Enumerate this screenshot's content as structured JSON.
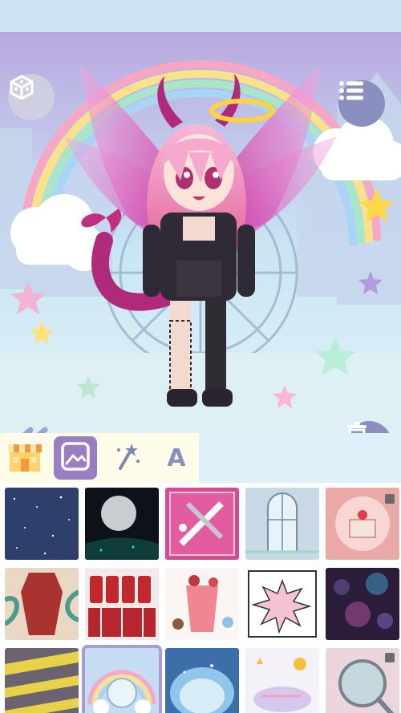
{
  "scene": {
    "buttons": {
      "random": "dice-icon",
      "menu": "list-menu-icon",
      "back": "double-chevron-left-icon",
      "delete": "trash-icon"
    }
  },
  "toolbar": {
    "tabs": [
      {
        "name": "shop",
        "icon": "shop-icon",
        "active": false
      },
      {
        "name": "background",
        "icon": "picture-frame-icon",
        "active": true
      },
      {
        "name": "effects",
        "icon": "magic-wand-icon",
        "active": false
      },
      {
        "name": "text",
        "label": "A",
        "active": false
      }
    ]
  },
  "backgrounds": {
    "rows": [
      [
        "night-sky",
        "full-moon-night",
        "syringe-pills",
        "arched-window-room",
        "strawberry-cake"
      ],
      [
        "red-coffin-vines",
        "blood-bags",
        "parfait-dessert",
        "comic-burst",
        "purple-bokeh"
      ],
      [
        "caution-tape",
        "rainbow-bubble-car",
        "starry-ice-cave",
        "sun-cloud-doodle",
        "magnifier-locked"
      ]
    ],
    "selected": "rainbow-bubble-car",
    "locked": [
      "strawberry-cake",
      "magnifier-locked"
    ]
  },
  "colors": {
    "accent": "#9a7ec2",
    "button": "#8a8fbf",
    "selected_outline": "#a89bd8"
  }
}
